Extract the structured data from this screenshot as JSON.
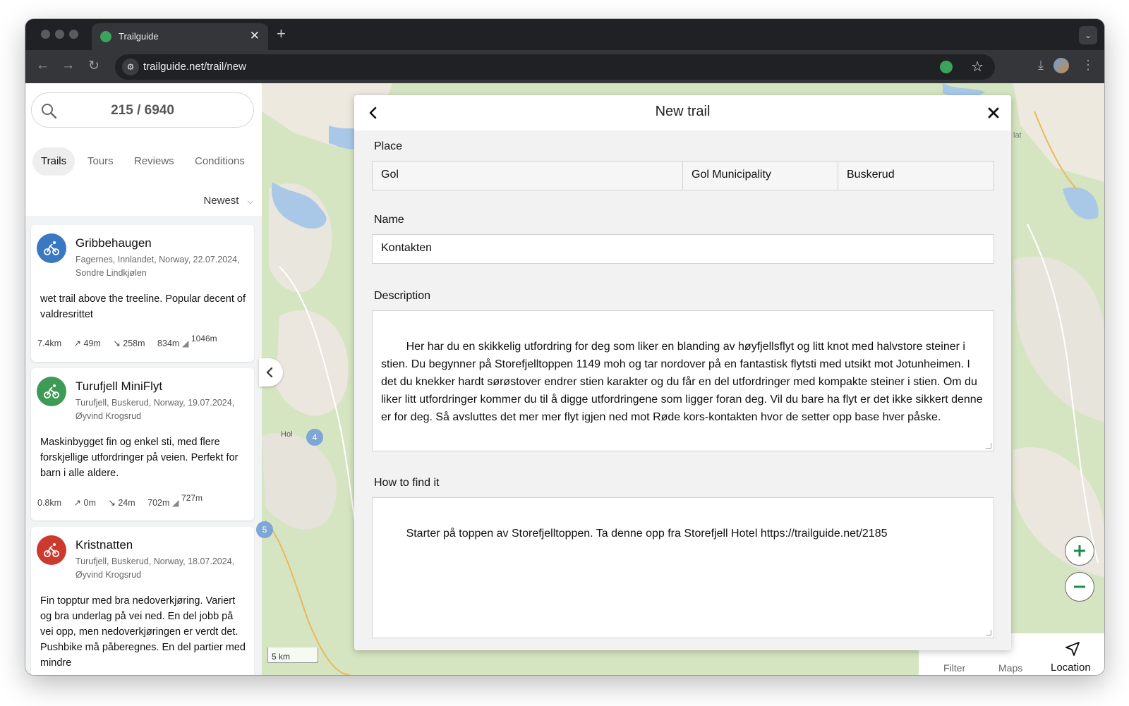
{
  "browser": {
    "tab_title": "Trailguide",
    "tab_close": "✕",
    "new_tab": "+",
    "url": "trailguide.net/trail/new"
  },
  "sidebar": {
    "search_count": "215 / 6940",
    "tabs": [
      "Trails",
      "Tours",
      "Reviews",
      "Conditions"
    ],
    "sort_label": "Newest",
    "cards": [
      {
        "title": "Gribbehaugen",
        "meta": "Fagernes, Innlandet, Norway, 22.07.2024, Sondre Lindkjølen",
        "text": "wet trail above the treeline. Popular decent of valdresrittet",
        "distance": "7.4km",
        "ascent": "49m",
        "descent": "258m",
        "bottom_alt": "834m",
        "top_alt": "1046m",
        "color": "#3b78c2"
      },
      {
        "title": "Turufjell MiniFlyt",
        "meta": "Turufjell, Buskerud, Norway, 19.07.2024, Øyvind Krogsrud",
        "text": "Maskinbygget fin og enkel sti, med flere forskjellige utfordringer på veien. Perfekt for barn i alle aldere.",
        "distance": "0.8km",
        "ascent": "0m",
        "descent": "24m",
        "bottom_alt": "702m",
        "top_alt": "727m",
        "color": "#3e9b55"
      },
      {
        "title": "Kristnatten",
        "meta": "Turufjell, Buskerud, Norway, 18.07.2024, Øyvind Krogsrud",
        "text": "Fin topptur med bra nedoverkjøring. Variert og bra underlag på vei ned. En del jobb på vei opp, men nedoverkjøringen er verdt det. Pushbike må påberegnes. En del partier med mindre",
        "color": "#cc3a2e"
      }
    ]
  },
  "map": {
    "place_label": "Hol",
    "badge_4": "4",
    "badge_5": "5",
    "edge_label": "lat",
    "scale": "5 km",
    "bottom_filter": "Filter",
    "bottom_maps": "Maps",
    "location_label": "Location"
  },
  "modal": {
    "title": "New trail",
    "place_label": "Place",
    "place": [
      "Gol",
      "Gol Municipality",
      "Buskerud"
    ],
    "name_label": "Name",
    "name_value": "Kontakten",
    "description_label": "Description",
    "description_value": "Her har du en skikkelig utfordring for deg som liker en blanding av høyfjellsflyt og litt knot med halvstore steiner i stien. Du begynner på Storefjelltoppen 1149 moh og tar nordover på en fantastisk flytsti med utsikt mot Jotunheimen. I det du knekker hardt sørøstover endrer stien karakter og du får en del utfordringer med kompakte steiner i stien. Om du liker litt utfordringer kommer du til å digge utfordringene som ligger foran deg. Vil du bare ha flyt er det ikke sikkert denne er for deg. Så avsluttes det mer mer flyt igjen ned mot Røde kors-kontakten hvor de setter opp base hver påske.",
    "howto_label": "How to find it",
    "howto_value": "Starter på toppen av Storefjelltoppen. Ta denne opp fra Storefjell Hotel https://trailguide.net/2185"
  }
}
